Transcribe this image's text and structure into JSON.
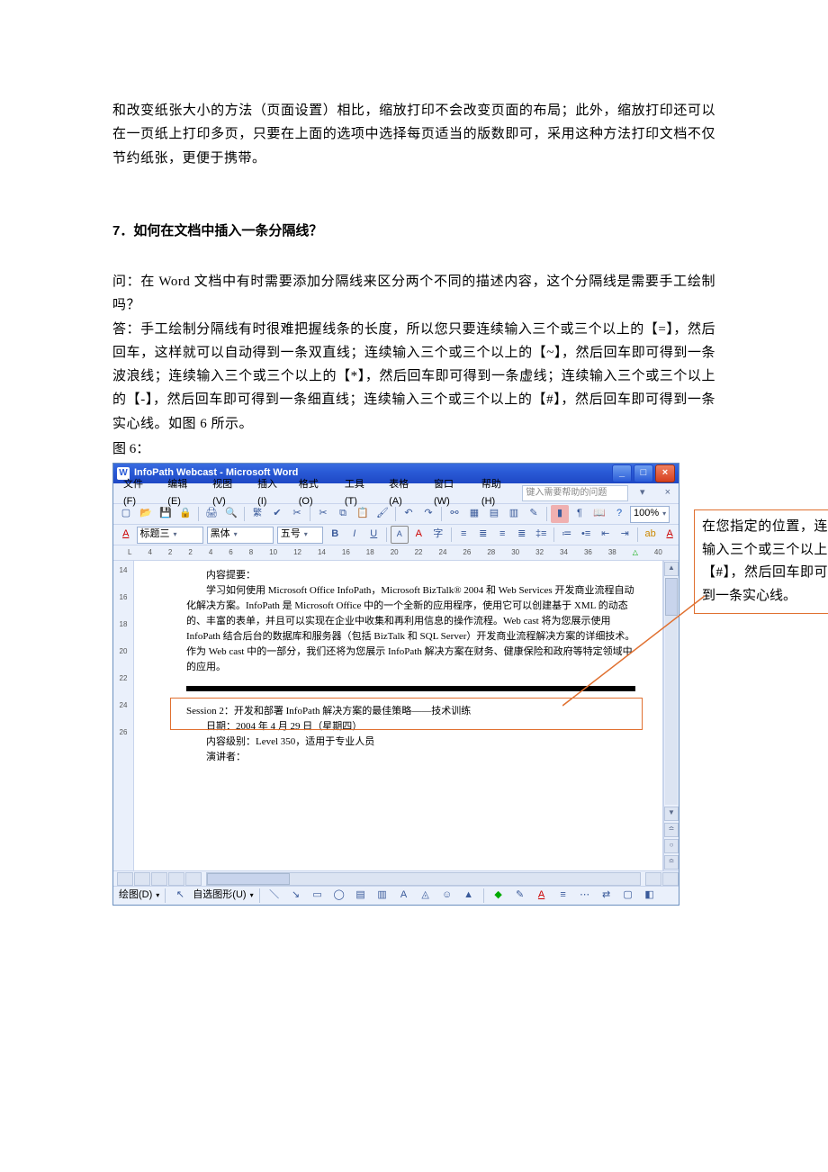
{
  "doc": {
    "intro_para": "和改变纸张大小的方法（页面设置）相比，缩放打印不会改变页面的布局；此外，缩放打印还可以在一页纸上打印多页，只要在上面的选项中选择每页适当的版数即可，采用这种方法打印文档不仅节约纸张，更便于携带。",
    "heading": "7．如何在文档中插入一条分隔线？",
    "q": "问：在 Word 文档中有时需要添加分隔线来区分两个不同的描述内容，这个分隔线是需要手工绘制吗？",
    "a": "答：手工绘制分隔线有时很难把握线条的长度，所以您只要连续输入三个或三个以上的【=】，然后回车，这样就可以自动得到一条双直线；连续输入三个或三个以上的【~】，然后回车即可得到一条波浪线；连续输入三个或三个以上的【*】，然后回车即可得到一条虚线；连续输入三个或三个以上的【-】，然后回车即可得到一条细直线；连续输入三个或三个以上的【#】，然后回车即可得到一条实心线。如图 6 所示。",
    "fig_label": "图 6："
  },
  "callout_text": "在您指定的位置，连续输入三个或三个以上的【#】，然后回车即可得到一条实心线。",
  "word": {
    "title": "InfoPath Webcast - Microsoft Word",
    "menu": [
      "文件(F)",
      "编辑(E)",
      "视图(V)",
      "插入(I)",
      "格式(O)",
      "工具(T)",
      "表格(A)",
      "窗口(W)",
      "帮助(H)"
    ],
    "help_placeholder": "键入需要帮助的问题",
    "zoom": "100%",
    "fmt": {
      "style": "标题三",
      "font": "黑体",
      "size": "五号"
    },
    "ruler_top": [
      "4",
      "2",
      "2",
      "4",
      "6",
      "8",
      "10",
      "12",
      "14",
      "16",
      "18",
      "20",
      "22",
      "24",
      "26",
      "28",
      "30",
      "32",
      "34",
      "36",
      "38"
    ],
    "ruler_top_tail": "40",
    "ruler_left": [
      "14",
      "16",
      "18",
      "20",
      "22",
      "24",
      "26"
    ],
    "content": {
      "h": "内容提要：",
      "p1": "学习如何使用 Microsoft Office InfoPath，Microsoft BizTalk® 2004 和 Web Services 开发商业流程自动化解决方案。InfoPath 是 Microsoft Office 中的一个全新的应用程序，使用它可以创建基于 XML 的动态的、丰富的表单，并且可以实现在企业中收集和再利用信息的操作流程。Web cast 将为您展示使用 InfoPath 结合后台的数据库和服务器（包括 BizTalk 和 SQL Server）开发商业流程解决方案的详细技术。作为 Web cast 中的一部分，我们还将为您展示 InfoPath 解决方案在财务、健康保险和政府等特定领域中的应用。",
      "s2": "Session 2：开发和部署 InfoPath 解决方案的最佳策略——技术训练",
      "date": "日期：2004 年 4 月 29 日（星期四）",
      "level": "内容级别：Level 350，适用于专业人员",
      "speaker": "演讲者："
    },
    "draw": {
      "label": "绘图(D)",
      "autoshape": "自选图形(U)"
    }
  }
}
